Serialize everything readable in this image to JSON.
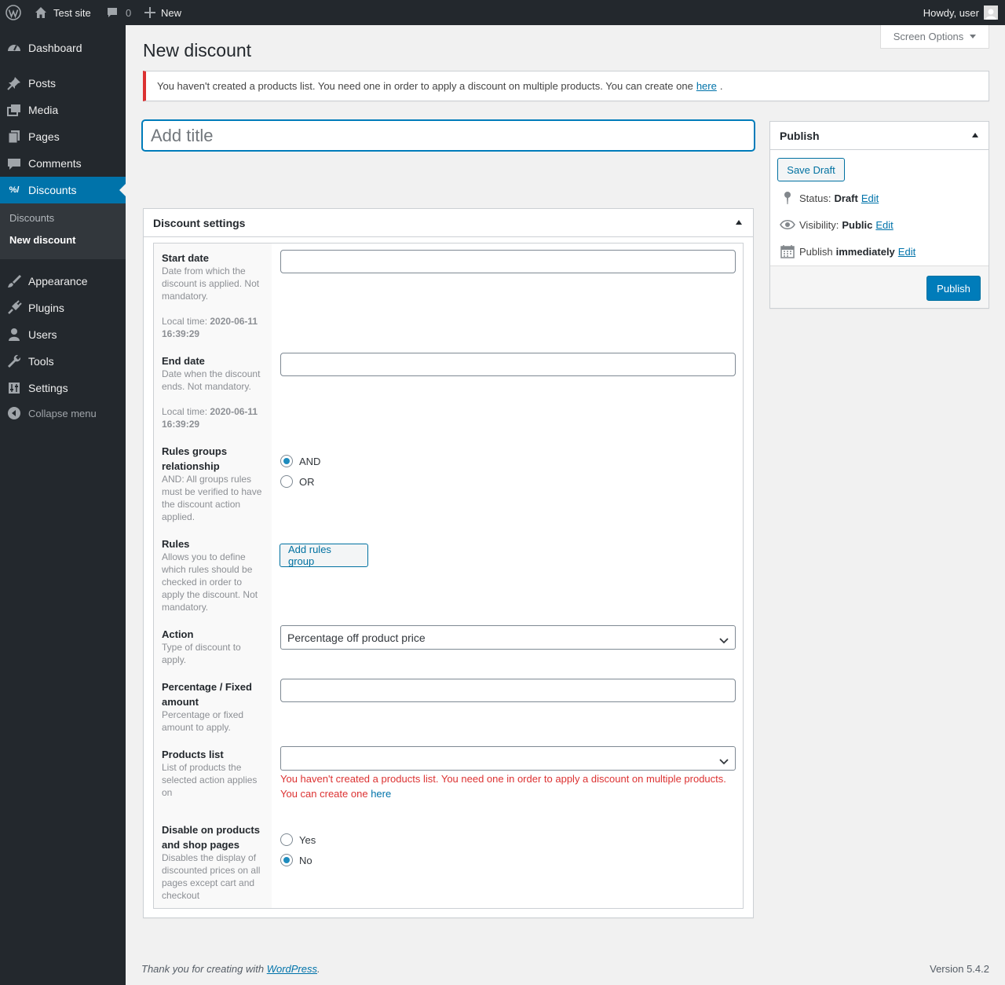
{
  "admin_bar": {
    "site_name": "Test site",
    "comments_count": "0",
    "new_label": "New",
    "howdy": "Howdy, user"
  },
  "sidebar": {
    "items": [
      {
        "label": "Dashboard",
        "icon": "dashboard-icon"
      },
      {
        "label": "Posts",
        "icon": "pushpin-icon"
      },
      {
        "label": "Media",
        "icon": "media-icon"
      },
      {
        "label": "Pages",
        "icon": "pages-icon"
      },
      {
        "label": "Comments",
        "icon": "comment-icon"
      },
      {
        "label": "Discounts",
        "icon": "discounts-icon"
      },
      {
        "label": "Appearance",
        "icon": "paintbrush-icon"
      },
      {
        "label": "Plugins",
        "icon": "plug-icon"
      },
      {
        "label": "Users",
        "icon": "user-icon"
      },
      {
        "label": "Tools",
        "icon": "wrench-icon"
      },
      {
        "label": "Settings",
        "icon": "sliders-icon"
      }
    ],
    "submenu": [
      "Discounts",
      "New discount"
    ],
    "collapse_label": "Collapse menu"
  },
  "screen_options": "Screen Options",
  "page_title": "New discount",
  "notice": {
    "text": "You haven't created a products list. You need one in order to apply a discount on multiple products. You can create one",
    "link": "here",
    "tail": "."
  },
  "title_input": {
    "placeholder": "Add title",
    "value": ""
  },
  "discount_settings": {
    "heading": "Discount settings",
    "start_date": {
      "label": "Start date",
      "desc": "Date from which the discount is applied. Not mandatory.",
      "local_time_label": "Local time:",
      "local_time": "2020-06-11 16:39:29",
      "value": ""
    },
    "end_date": {
      "label": "End date",
      "desc": "Date when the discount ends. Not mandatory.",
      "local_time_label": "Local time:",
      "local_time": "2020-06-11 16:39:29",
      "value": ""
    },
    "rules_groups": {
      "label": "Rules groups relationship",
      "desc": "AND: All groups rules must be verified to have the discount action applied.",
      "options": [
        "AND",
        "OR"
      ],
      "selected": "AND"
    },
    "rules": {
      "label": "Rules",
      "desc": "Allows you to define which rules should be checked in order to apply the discount. Not mandatory.",
      "button": "Add rules group"
    },
    "action": {
      "label": "Action",
      "desc": "Type of discount to apply.",
      "selected": "Percentage off product price"
    },
    "amount": {
      "label": "Percentage / Fixed amount",
      "desc": "Percentage or fixed amount to apply.",
      "value": ""
    },
    "products_list": {
      "label": "Products list",
      "desc": "List of products the selected action applies on",
      "selected": "",
      "error_line1": "You haven't created a products list. You need one in order to apply a discount on multiple products.",
      "error_line2": "You can create one",
      "error_link": "here"
    },
    "disable_shop": {
      "label": "Disable on products and shop pages",
      "desc": "Disables the display of discounted prices on all pages except cart and checkout",
      "options": [
        "Yes",
        "No"
      ],
      "selected": "No"
    }
  },
  "publish": {
    "heading": "Publish",
    "save_draft": "Save Draft",
    "status_label": "Status:",
    "status_value": "Draft",
    "visibility_label": "Visibility:",
    "visibility_value": "Public",
    "publish_label": "Publish",
    "publish_value": "immediately",
    "edit_label": "Edit",
    "publish_button": "Publish"
  },
  "footer": {
    "thanks": "Thank you for creating with",
    "wp_link": "WordPress",
    "period": ".",
    "version": "Version 5.4.2"
  },
  "colors": {
    "accent": "#0073aa",
    "sidebar": "#23282d",
    "error": "#dc3232",
    "primary_button": "#007cba"
  }
}
